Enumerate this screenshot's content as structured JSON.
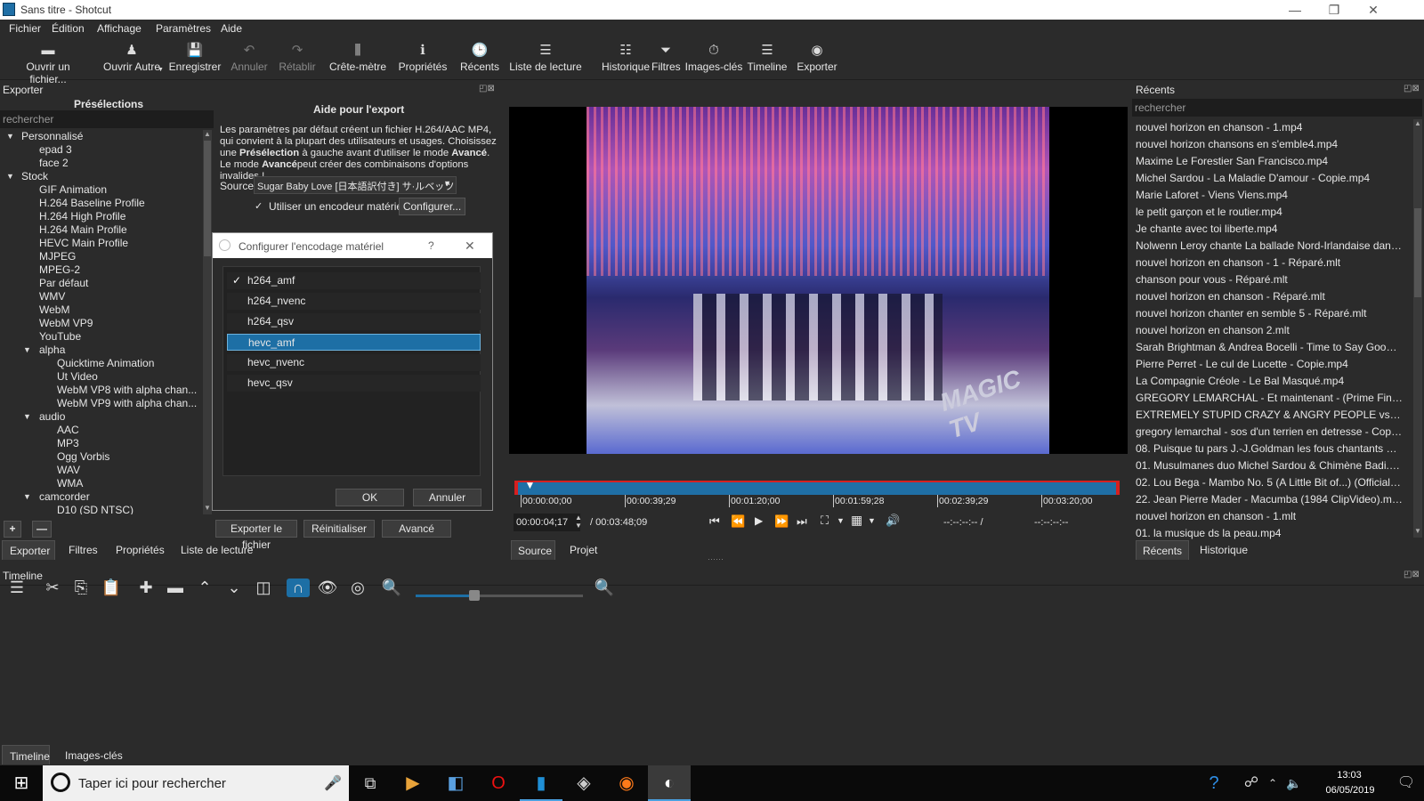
{
  "window": {
    "title": "Sans titre - Shotcut",
    "min": "—",
    "max": "❐",
    "close": "✕"
  },
  "menu": [
    "Fichier",
    "Édition",
    "Affichage",
    "Paramètres",
    "Aide"
  ],
  "toolbar": [
    {
      "label": "Ouvrir un fichier...",
      "icon": "open-file-icon",
      "glyph": "▬",
      "enabled": true
    },
    {
      "label": "Ouvrir Autre",
      "icon": "open-other-icon",
      "glyph": "♟",
      "enabled": true
    },
    {
      "label": "Enregistrer",
      "icon": "save-icon",
      "glyph": "💾",
      "enabled": true
    },
    {
      "label": "Annuler",
      "icon": "undo-icon",
      "glyph": "↶",
      "enabled": false
    },
    {
      "label": "Rétablir",
      "icon": "redo-icon",
      "glyph": "↷",
      "enabled": false
    },
    {
      "label": "Crête-mètre",
      "icon": "peak-meter-icon",
      "glyph": "⫼",
      "enabled": true
    },
    {
      "label": "Propriétés",
      "icon": "properties-icon",
      "glyph": "ℹ",
      "enabled": true
    },
    {
      "label": "Récents",
      "icon": "recent-icon",
      "glyph": "🕒",
      "enabled": true
    },
    {
      "label": "Liste de lecture",
      "icon": "playlist-icon",
      "glyph": "☰",
      "enabled": true
    },
    {
      "label": "Historique",
      "icon": "history-icon",
      "glyph": "☷",
      "enabled": true
    },
    {
      "label": "Filtres",
      "icon": "filter-icon",
      "glyph": "⏷",
      "enabled": true
    },
    {
      "label": "Images-clés",
      "icon": "keyframes-icon",
      "glyph": "⏱",
      "enabled": true
    },
    {
      "label": "Timeline",
      "icon": "timeline-icon",
      "glyph": "☰",
      "enabled": true
    },
    {
      "label": "Exporter",
      "icon": "export-icon",
      "glyph": "◉",
      "enabled": true
    }
  ],
  "export_panel": {
    "dock_title": "Exporter",
    "presets_title": "Présélections",
    "search_placeholder": "rechercher",
    "help_title": "Aide pour l'export",
    "help_text_1": "Les paramètres par défaut créent un fichier H.264/AAC MP4, qui convient à la plupart des utilisateurs et usages. Choisissez une ",
    "help_bold_1": "Présélection",
    "help_text_2": " à gauche avant d'utiliser le mode ",
    "help_bold_2": "Avancé",
    "help_text_3": ". Le mode ",
    "help_bold_3": "Avancé",
    "help_text_4": "peut créer des combinaisons d'options invalides !",
    "source_label": "Source",
    "source_value": "Sugar Baby Love [日本語訳付き] サ·ルベッツ",
    "hw_encoder_label": "Utiliser un encodeur matériel",
    "configure_button": "Configurer...",
    "export_file_button": "Exporter le fichier",
    "reset_button": "Réinitialiser",
    "advanced_button": "Avancé",
    "add_button": "+",
    "remove_button": "—",
    "tabs": [
      "Exporter",
      "Filtres",
      "Propriétés",
      "Liste de lecture"
    ]
  },
  "presets_tree": [
    {
      "label": "Personnalisé",
      "level": 0,
      "arrow": "▼"
    },
    {
      "label": "epad 3",
      "level": 2
    },
    {
      "label": "face 2",
      "level": 2
    },
    {
      "label": "Stock",
      "level": 0,
      "arrow": "▼"
    },
    {
      "label": "GIF Animation",
      "level": 1
    },
    {
      "label": "H.264 Baseline Profile",
      "level": 1
    },
    {
      "label": "H.264 High Profile",
      "level": 1
    },
    {
      "label": "H.264 Main Profile",
      "level": 1
    },
    {
      "label": "HEVC Main Profile",
      "level": 1
    },
    {
      "label": "MJPEG",
      "level": 1
    },
    {
      "label": "MPEG-2",
      "level": 1
    },
    {
      "label": "Par défaut",
      "level": 1
    },
    {
      "label": "WMV",
      "level": 1
    },
    {
      "label": "WebM",
      "level": 1
    },
    {
      "label": "WebM VP9",
      "level": 1
    },
    {
      "label": "YouTube",
      "level": 1
    },
    {
      "label": "alpha",
      "level": 1,
      "arrow": "▼"
    },
    {
      "label": "Quicktime Animation",
      "level": 2
    },
    {
      "label": "Ut Video",
      "level": 2
    },
    {
      "label": "WebM VP8 with alpha chan...",
      "level": 2
    },
    {
      "label": "WebM VP9 with alpha chan...",
      "level": 2
    },
    {
      "label": "audio",
      "level": 1,
      "arrow": "▼"
    },
    {
      "label": "AAC",
      "level": 2
    },
    {
      "label": "MP3",
      "level": 2
    },
    {
      "label": "Ogg Vorbis",
      "level": 2
    },
    {
      "label": "WAV",
      "level": 2
    },
    {
      "label": "WMA",
      "level": 2
    },
    {
      "label": "camcorder",
      "level": 1,
      "arrow": "▼"
    },
    {
      "label": "D10 (SD NTSC)",
      "level": 2
    }
  ],
  "dialog": {
    "title": "Configurer l'encodage matériel",
    "help": "?",
    "close": "✕",
    "items": [
      {
        "label": "h264_amf",
        "checked": true,
        "selected": false
      },
      {
        "label": "h264_nvenc",
        "checked": false,
        "selected": false
      },
      {
        "label": "h264_qsv",
        "checked": false,
        "selected": false
      },
      {
        "label": "hevc_amf",
        "checked": false,
        "selected": true
      },
      {
        "label": "hevc_nvenc",
        "checked": false,
        "selected": false
      },
      {
        "label": "hevc_qsv",
        "checked": false,
        "selected": false
      }
    ],
    "ok": "OK",
    "cancel": "Annuler"
  },
  "player": {
    "ruler_ticks": [
      "00:00:00;00",
      "00:00:39;29",
      "00:01:20;00",
      "00:01:59;28",
      "00:02:39;29",
      "00:03:20;00"
    ],
    "current_time": "00:00:04;17",
    "total_time": "/ 00:03:48;09",
    "in_point": "--:--:--:-- /",
    "out_point": "--:--:--:--",
    "tabs": [
      "Source",
      "Projet"
    ],
    "watermark": "MAGIC TV",
    "progress_fraction": 0.02
  },
  "recents": {
    "dock_title": "Récents",
    "search_placeholder": "rechercher",
    "items": [
      "nouvel horizon en chanson - 1.mp4",
      "nouvel horizon chansons en s'emble4.mp4",
      "Maxime Le Forestier San Francisco.mp4",
      "Michel Sardou - La Maladie D'amour - Copie.mp4",
      "Marie Laforet - Viens Viens.mp4",
      "le petit garçon et le routier.mp4",
      "Je chante avec toi liberte.mp4",
      "Nolwenn Leroy chante La ballade Nord-Irlandaise dans ...",
      "nouvel horizon en chanson - 1 - Réparé.mlt",
      "chanson pour vous - Réparé.mlt",
      "nouvel horizon en chanson - Réparé.mlt",
      "nouvel horizon chanter en semble 5 - Réparé.mlt",
      "nouvel horizon en chanson 2.mlt",
      "Sarah Brightman & Andrea Bocelli - Time to Say Goodb...",
      "Pierre Perret - Le cul de Lucette - Copie.mp4",
      "La Compagnie Créole - Le Bal Masqué.mp4",
      "GREGORY LEMARCHAL - Et maintenant - (Prime Finale ...",
      "EXTREMELY STUPID CRAZY & ANGRY PEOPLE vs BIKER...",
      "gregory lemarchal - sos d'un terrien en detresse - Copie...",
      "08. Puisque tu pars J.-J.Goldman les fous chantants d'Al...",
      "01. Musulmanes duo Michel Sardou & Chimène Badi.m...",
      "02. Lou Bega - Mambo No. 5 (A Little Bit of...) (Official V...",
      "22. Jean Pierre Mader - Macumba (1984 ClipVideo).mp4",
      "nouvel horizon en chanson - 1.mlt",
      "01. la musique ds la peau.mp4"
    ],
    "tabs": [
      "Récents",
      "Historique"
    ]
  },
  "timeline": {
    "dock_title": "Timeline",
    "tabs": [
      "Timeline",
      "Images-clés"
    ],
    "zoom_fraction": 0.35
  },
  "taskbar": {
    "search_placeholder": "Taper ici pour rechercher",
    "time": "13:03",
    "date": "06/05/2019"
  },
  "colors": {
    "accent": "#1d6fa5",
    "background": "#2b2b2b",
    "playhead": "#d62020"
  }
}
